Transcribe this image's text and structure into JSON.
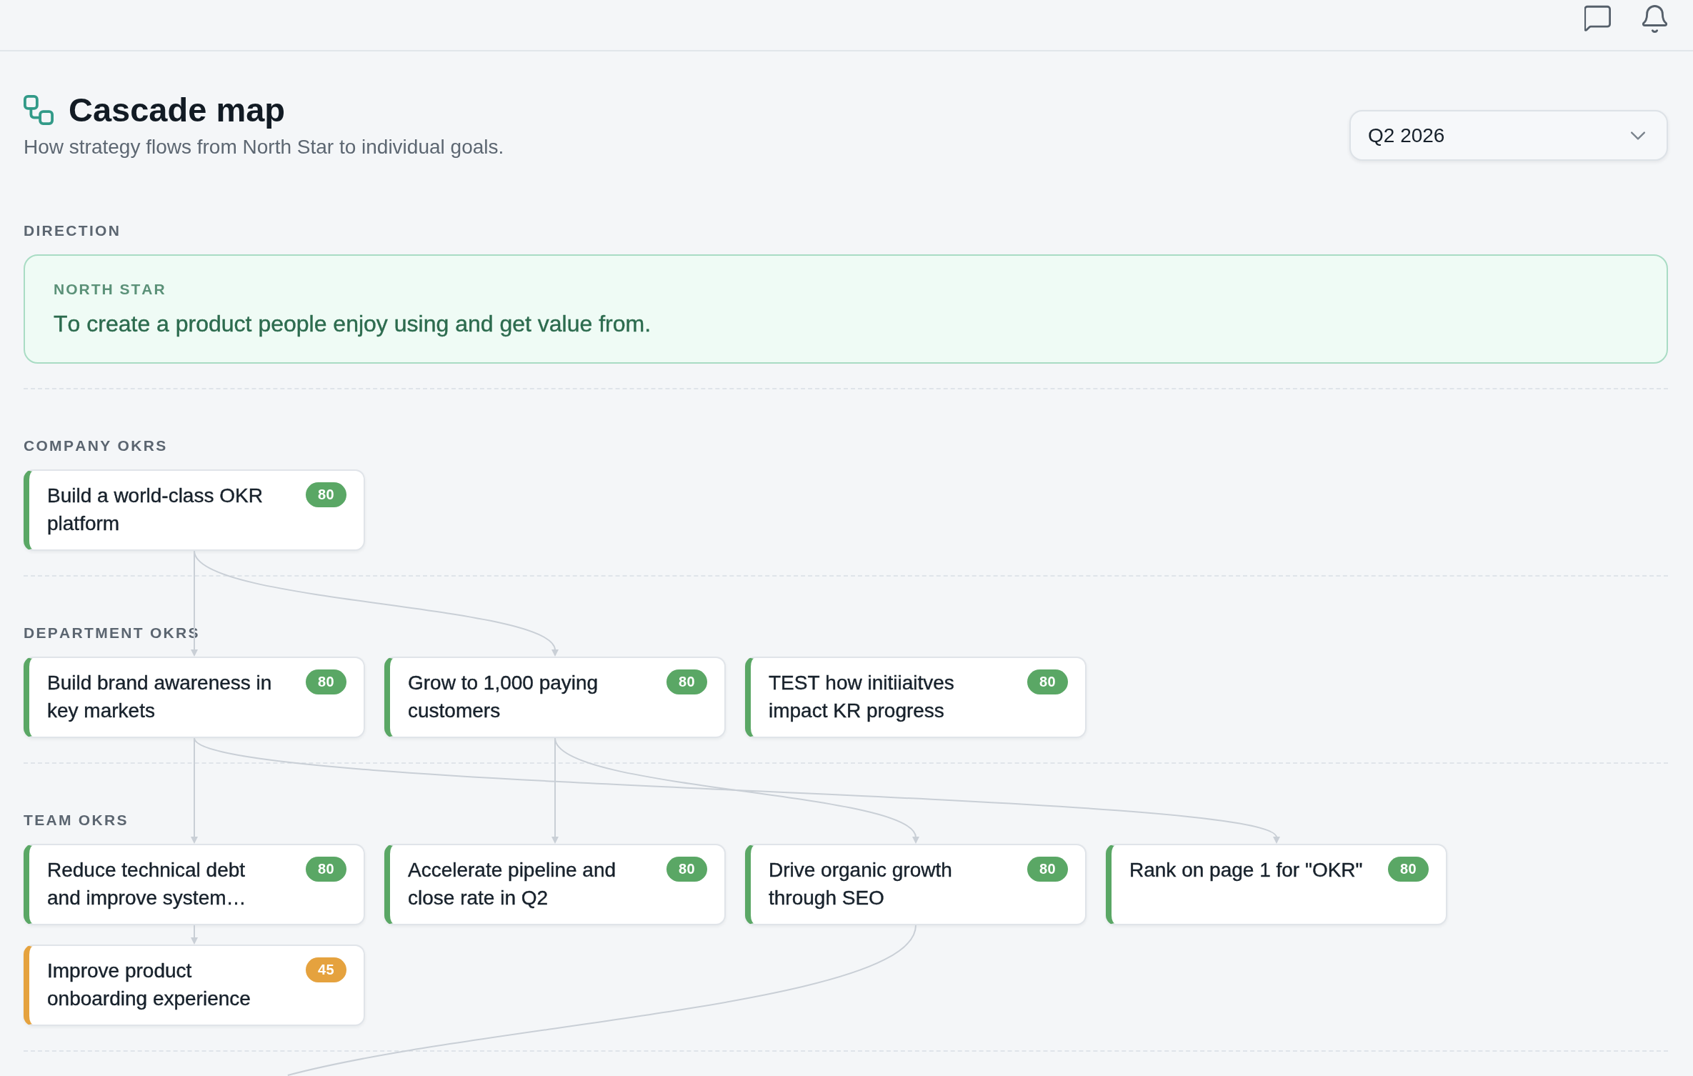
{
  "header": {
    "title": "Cascade map",
    "subtitle": "How strategy flows from North Star to individual goals.",
    "period_select": {
      "value": "Q2 2026"
    }
  },
  "sections": [
    {
      "kind": "direction",
      "label": "DIRECTION",
      "north_star": {
        "label": "NORTH STAR",
        "text": "To create a product people enjoy using and get value from."
      }
    },
    {
      "kind": "okrs",
      "label": "COMPANY OKRS",
      "cards": [
        {
          "title": "Build a world-class OKR platform",
          "score": "80",
          "color": "#5aa765"
        }
      ]
    },
    {
      "kind": "okrs",
      "label": "DEPARTMENT OKRS",
      "cards": [
        {
          "title": "Build brand awareness in key markets",
          "score": "80",
          "color": "#5aa765",
          "from_above": [
            true
          ]
        },
        {
          "title": "Grow to 1,000 paying customers",
          "score": "80",
          "color": "#5aa765",
          "from_above": [
            true
          ]
        },
        {
          "title": "TEST how initiiaitves impact KR progress",
          "score": "80",
          "color": "#5aa765",
          "from_above": [
            false
          ]
        }
      ]
    },
    {
      "kind": "okrs",
      "label": "TEAM OKRS",
      "cards": [
        {
          "title": "Reduce technical debt and improve system…",
          "score": "80",
          "color": "#5aa765",
          "from_above": [
            true,
            false,
            false
          ],
          "children": [
            {
              "title": "Improve product onboarding experience",
              "score": "45",
              "color": "#e5a23e"
            }
          ]
        },
        {
          "title": "Accelerate pipeline and close rate in Q2",
          "score": "80",
          "color": "#5aa765",
          "from_above": [
            false,
            true,
            false
          ]
        },
        {
          "title": "Drive organic growth through SEO",
          "score": "80",
          "color": "#5aa765",
          "from_above": [
            false,
            true,
            false
          ],
          "continues_below": true
        },
        {
          "title": "Rank on page 1 for \"OKR\"",
          "score": "80",
          "color": "#5aa765",
          "from_above": [
            true,
            false,
            false
          ]
        }
      ]
    }
  ]
}
